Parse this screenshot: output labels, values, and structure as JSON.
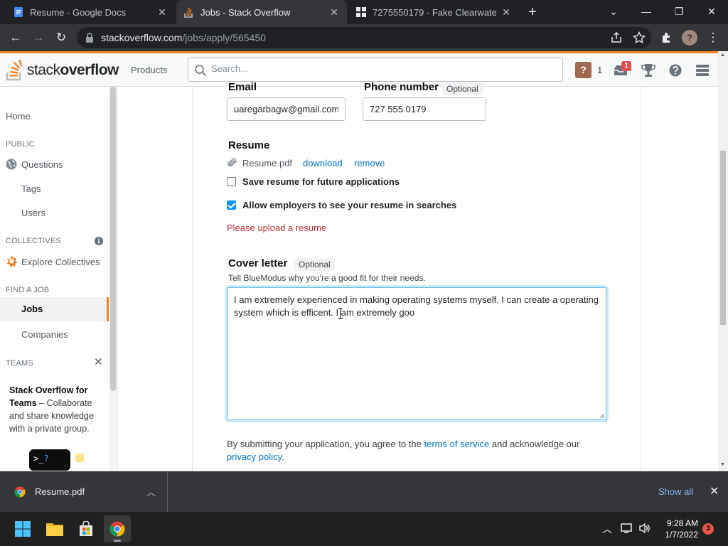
{
  "browser": {
    "tabs": [
      {
        "title": "Resume - Google Docs",
        "active": false
      },
      {
        "title": "Jobs - Stack Overflow",
        "active": true
      },
      {
        "title": "7275550179 - Fake Clearwater Ph",
        "active": false
      }
    ],
    "url_host": "stackoverflow.com",
    "url_path": "/jobs/apply/565450",
    "profile_initial": "?"
  },
  "header": {
    "logo_stack": "stack",
    "logo_overflow": "overflow",
    "products_label": "Products",
    "search_placeholder": "Search...",
    "rep_badge": "?",
    "rep_count": "1",
    "inbox_count": "1"
  },
  "leftnav": {
    "home": "Home",
    "public_heading": "PUBLIC",
    "questions": "Questions",
    "tags": "Tags",
    "users": "Users",
    "collectives_heading": "COLLECTIVES",
    "explore_collectives": "Explore Collectives",
    "find_job_heading": "FIND A JOB",
    "jobs": "Jobs",
    "companies": "Companies",
    "teams_heading": "TEAMS",
    "teams_title": "Stack Overflow for Teams",
    "teams_desc": " – Collaborate and share knowledge with a private group."
  },
  "form": {
    "email_label": "Email",
    "email_value": "uaregarbagw@gmail.com",
    "phone_label": "Phone number",
    "phone_optional": "Optional",
    "phone_value": "727 555 0179",
    "resume_label": "Resume",
    "resume_file": "Resume.pdf",
    "resume_download": "download",
    "resume_remove": "remove",
    "save_resume_label": "Save resume for future applications",
    "save_resume_checked": false,
    "allow_employers_label": "Allow employers to see your resume in searches",
    "allow_employers_checked": true,
    "resume_error": "Please upload a resume",
    "cover_label": "Cover letter",
    "cover_optional": "Optional",
    "cover_hint": "Tell BlueModus why you're a good fit for their needs.",
    "cover_value": "I am extremely experienced in making operating systems myself. I can create a operating system which is efficent. I am extremely goo",
    "tos_prefix": "By submitting your application, you agree to the ",
    "tos_link": "terms of service",
    "tos_middle": " and acknowledge our ",
    "privacy_link": "privacy policy",
    "tos_suffix": "."
  },
  "downloads": {
    "file_name": "Resume.pdf",
    "show_all": "Show all"
  },
  "taskbar": {
    "time": "9:28 AM",
    "date": "1/7/2022",
    "notification_count": "3"
  },
  "colors": {
    "so_orange": "#f48225",
    "link_blue": "#0074cc",
    "error_red": "#c22e32"
  }
}
